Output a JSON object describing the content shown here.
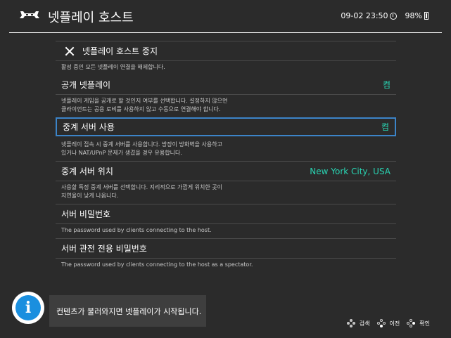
{
  "header": {
    "title": "넷플레이 호스트",
    "datetime": "09-02 23:50",
    "battery": "98%"
  },
  "menu": {
    "stop_host": {
      "label": "넷플레이 호스트 중지",
      "desc": "활성 중인 모든 넷플레이 연결을 해제합니다."
    },
    "public_netplay": {
      "label": "공개 넷플레이",
      "value": "켬",
      "desc_line1": "넷플레이 게임을 공개로 할 것인지 여부를 선택합니다. 설정하지 않으면",
      "desc_line2": "클라이언트는 공용 로비를 사용하지 않고 수동으로 연결해야 합니다."
    },
    "relay_server": {
      "label": "중계 서버 사용",
      "value": "켬",
      "desc_line1": "넷플레이 접속 시 중계 서버를 사용합니다. 방장이 방화벽을 사용하고",
      "desc_line2": "있거나 NAT/UPnP 문제가 생겼을 경우 유용합니다."
    },
    "relay_location": {
      "label": "중계 서버 위치",
      "value": "New York City, USA",
      "desc_line1": "사용할 특정 중계 서버를 선택합니다. 지리적으로 가깝게 위치한 곳이",
      "desc_line2": "지연율이 낮게 나옵니다."
    },
    "server_password": {
      "label": "서버 비밀번호",
      "desc": "The password used by clients connecting to the host."
    },
    "spectator_password": {
      "label": "서버 관전 전용 비밀번호",
      "desc": "The password used by clients connecting to the host as a spectator."
    }
  },
  "toast": {
    "message": "컨텐츠가 불러와지면 넷플레이가 시작됩니다."
  },
  "footer": {
    "search": "검색",
    "back": "이전",
    "ok": "확인"
  },
  "colors": {
    "accent": "#29d3b2",
    "selection": "#3c84c8",
    "background": "#2b2b2b",
    "info": "#1a8fdf"
  }
}
